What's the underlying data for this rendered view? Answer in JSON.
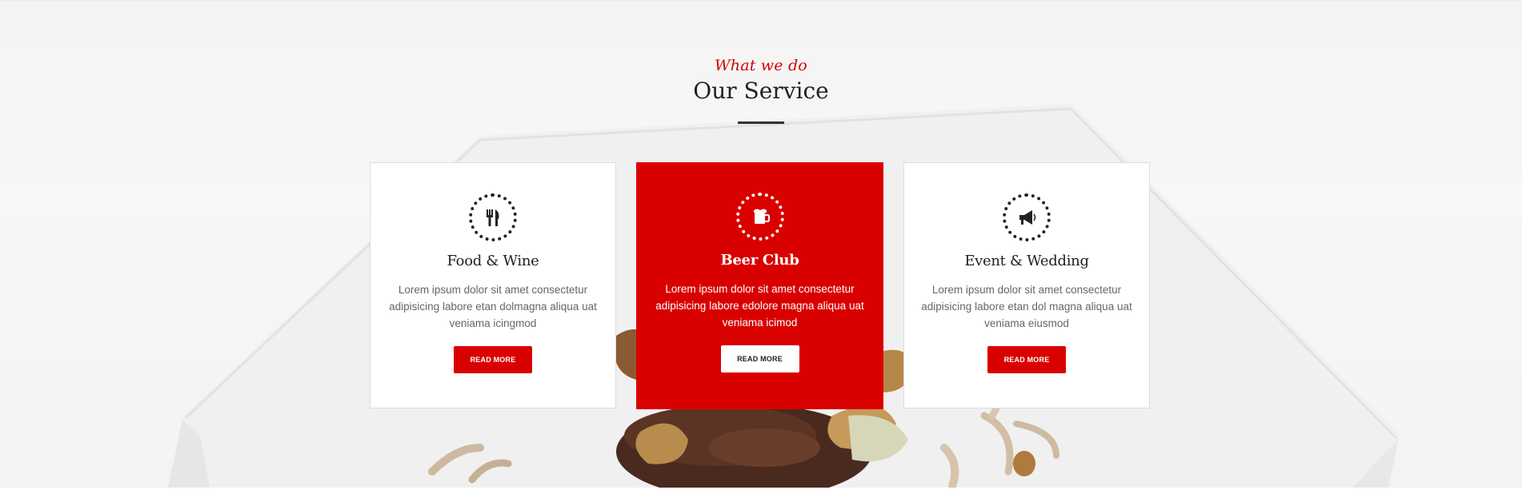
{
  "section": {
    "eyebrow": "What we do",
    "title": "Our Service"
  },
  "cards": [
    {
      "icon": "fork-knife-icon",
      "title": "Food & Wine",
      "text": "Lorem ipsum dolor sit amet consectetur adipisicing labore etan dolmagna aliqua uat veniama icingmod",
      "button": "READ MORE"
    },
    {
      "icon": "beer-mug-icon",
      "title": "Beer Club",
      "text": "Lorem ipsum dolor sit amet consectetur adipisicing labore edolore magna aliqua uat veniama icimod",
      "button": "READ MORE"
    },
    {
      "icon": "megaphone-icon",
      "title": "Event & Wedding",
      "text": "Lorem ipsum dolor sit amet consectetur adipisicing labore etan dol magna aliqua uat veniama eiusmod",
      "button": "READ MORE"
    }
  ],
  "colors": {
    "accent": "#d90000",
    "heading": "#222222",
    "body_text": "#666666",
    "background": "#f4f4f5"
  }
}
